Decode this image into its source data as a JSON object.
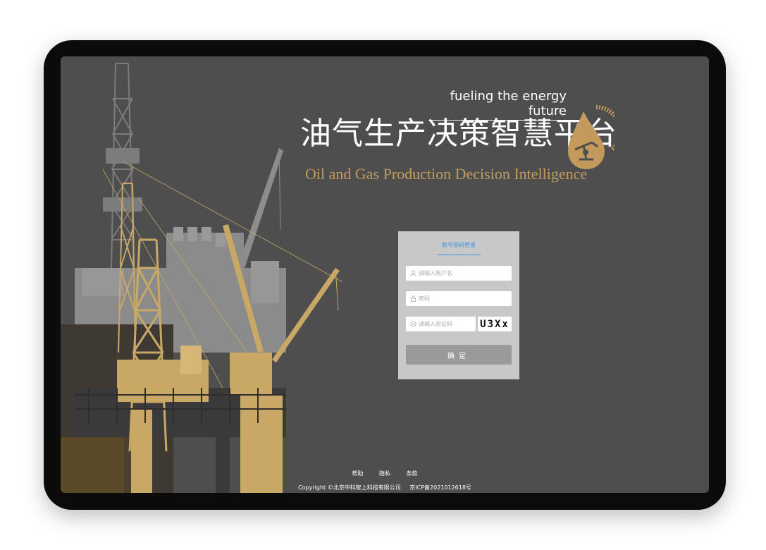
{
  "header": {
    "tagline": "fueling the energy future",
    "title_cn": "油气生产决策智慧平台",
    "title_en": "Oil and Gas Production Decision Intelligence"
  },
  "logo": {
    "icon": "oil-drop-pumpjack-icon",
    "accent": "#c39a5c"
  },
  "login": {
    "tab_label": "账号密码登录",
    "username_placeholder": "请输入账户名",
    "password_placeholder": "密码",
    "captcha_placeholder": "请输入验证码",
    "captcha_code": "U3Xx",
    "submit_label": "确定"
  },
  "footer": {
    "links": [
      "帮助",
      "隐私",
      "条款"
    ],
    "copyright": "Copyright ©北京中科智上科技有限公司",
    "icp": "京ICP备2021012618号"
  },
  "colors": {
    "background": "#4e4e4e",
    "gold": "#c9a865",
    "gray_structure": "#8a8a8a",
    "accent_blue": "#3b8fe6"
  }
}
